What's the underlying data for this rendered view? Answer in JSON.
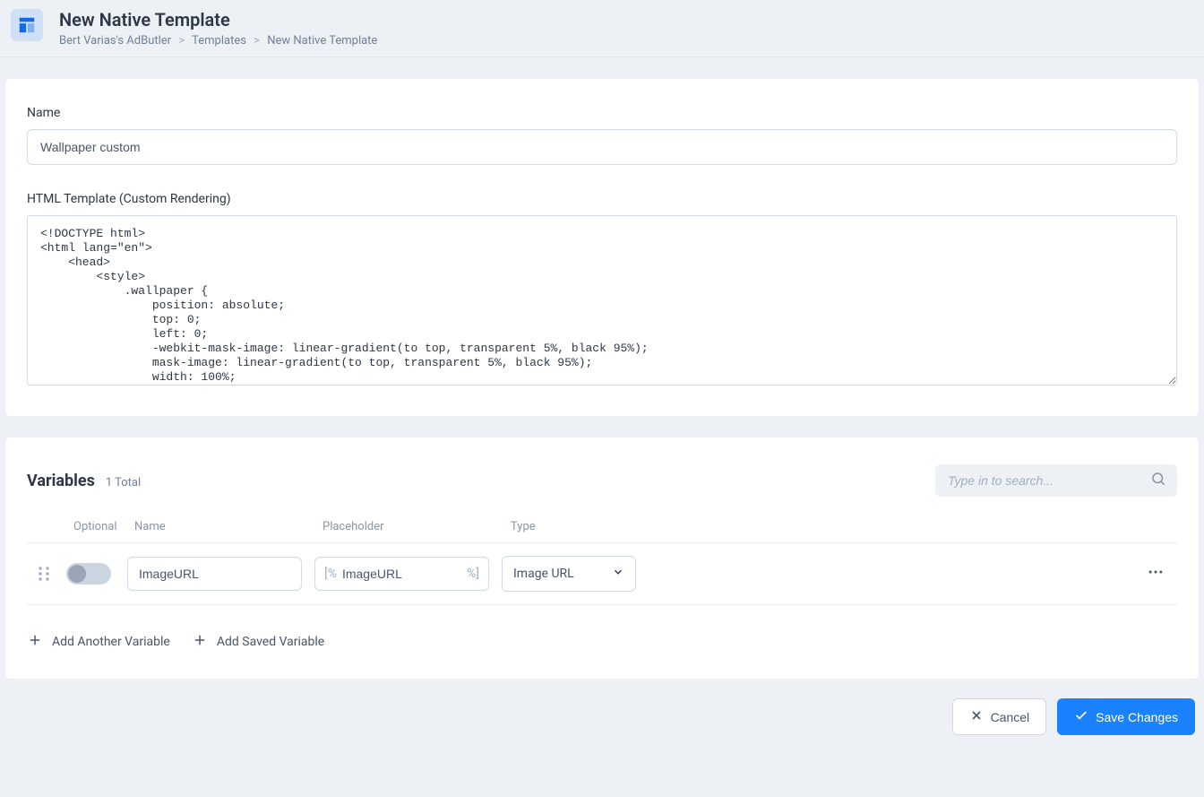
{
  "header": {
    "title": "New Native Template",
    "breadcrumb": {
      "root": "Bert Varias's AdButler",
      "mid": "Templates",
      "leaf": "New Native Template"
    }
  },
  "form": {
    "name_label": "Name",
    "name_value": "Wallpaper custom",
    "html_label": "HTML Template (Custom Rendering)",
    "html_value": "<!DOCTYPE html>\n<html lang=\"en\">\n    <head>\n        <style>\n            .wallpaper {\n                position: absolute;\n                top: 0;\n                left: 0;\n                -webkit-mask-image: linear-gradient(to top, transparent 5%, black 95%);\n                mask-image: linear-gradient(to top, transparent 5%, black 95%);\n                width: 100%;"
  },
  "variables": {
    "title": "Variables",
    "count_text": "1 Total",
    "search_placeholder": "Type in to search...",
    "columns": {
      "optional": "Optional",
      "name": "Name",
      "placeholder": "Placeholder",
      "type": "Type"
    },
    "row": {
      "name_value": "ImageURL",
      "placeholder_prefix": "[%",
      "placeholder_value": "ImageURL",
      "placeholder_suffix": "%]",
      "type_value": "Image URL"
    },
    "add_another": "Add Another Variable",
    "add_saved": "Add Saved Variable"
  },
  "footer": {
    "cancel": "Cancel",
    "save": "Save Changes"
  }
}
